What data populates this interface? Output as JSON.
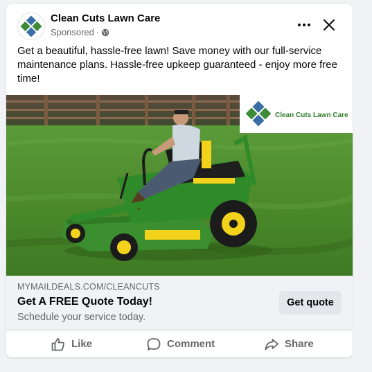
{
  "post": {
    "page_name": "Clean Cuts Lawn Care",
    "sponsored_label": "Sponsored",
    "separator": "·",
    "body": "Get a beautiful, hassle-free lawn! Save money with our full-service maintenance plans. Hassle-free upkeep guaranteed - enjoy more free time!"
  },
  "image": {
    "logo_text": "Clean Cuts Lawn Care"
  },
  "link": {
    "domain": "MYMAILDEALS.COM/CLEANCUTS",
    "headline": "Get A FREE Quote Today!",
    "description": "Schedule your service today.",
    "cta": "Get quote"
  },
  "actions": {
    "like": "Like",
    "comment": "Comment",
    "share": "Share"
  },
  "icons": {
    "more": "more-options-icon",
    "close": "close-icon",
    "globe": "globe-icon",
    "like": "thumbs-up-icon",
    "comment": "comment-bubble-icon",
    "share": "share-arrow-icon"
  },
  "colors": {
    "logo_blue": "#3a6ea5",
    "logo_green": "#3d8b37",
    "grass": "#4a8c2a",
    "mower_green": "#3b8f2e",
    "mower_yellow": "#f3d21b",
    "logo_text_green": "#2f7d2a"
  }
}
